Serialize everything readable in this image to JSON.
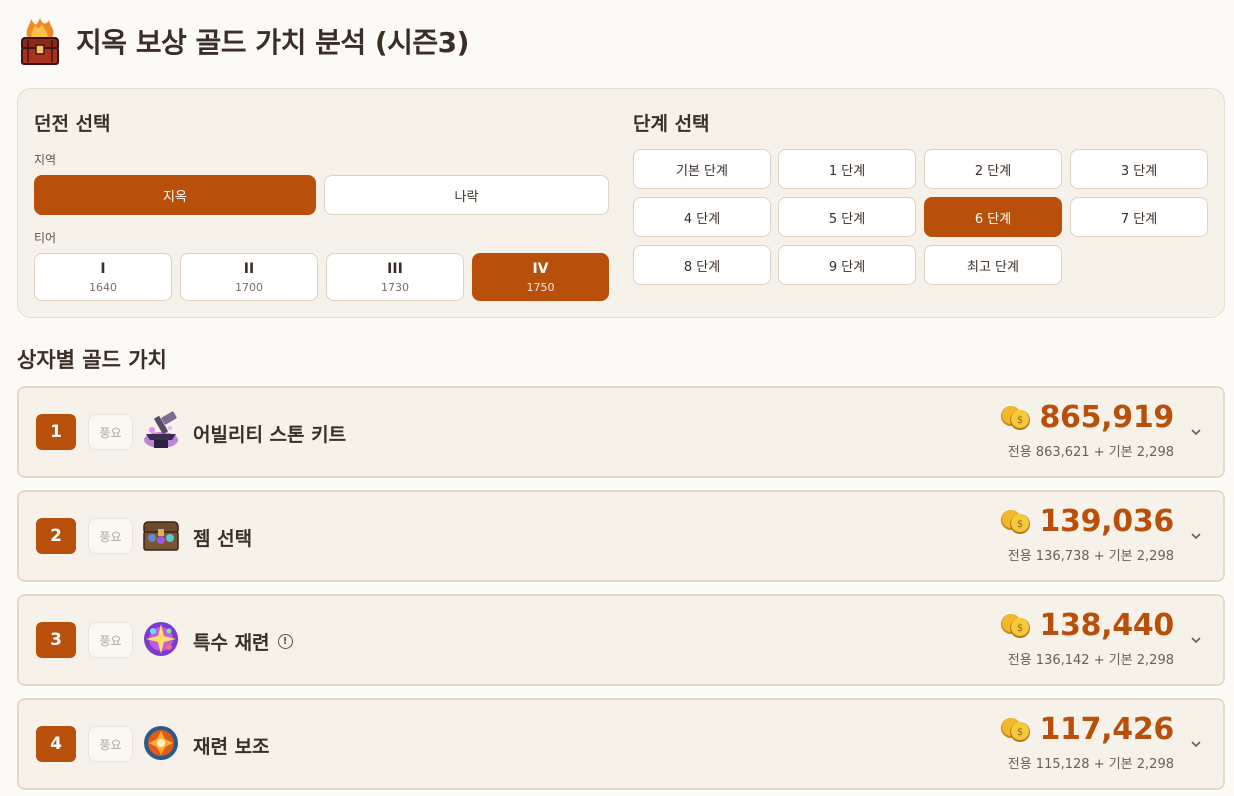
{
  "page": {
    "title": "지옥 보상 골드 가치 분석 (시즌3)",
    "title_icon": "flaming-treasure-chest-icon"
  },
  "dungeon": {
    "heading": "던전 선택",
    "region_label": "지역",
    "regions": [
      {
        "label": "지옥",
        "active": true
      },
      {
        "label": "나락",
        "active": false
      }
    ],
    "tier_label": "티어",
    "tiers": [
      {
        "roman": "I",
        "level": "1640",
        "active": false
      },
      {
        "roman": "II",
        "level": "1700",
        "active": false
      },
      {
        "roman": "III",
        "level": "1730",
        "active": false
      },
      {
        "roman": "IV",
        "level": "1750",
        "active": true
      }
    ]
  },
  "stage": {
    "heading": "단계 선택",
    "options": [
      {
        "label": "기본 단계",
        "active": false
      },
      {
        "label": "1 단계",
        "active": false
      },
      {
        "label": "2 단계",
        "active": false
      },
      {
        "label": "3 단계",
        "active": false
      },
      {
        "label": "4 단계",
        "active": false
      },
      {
        "label": "5 단계",
        "active": false
      },
      {
        "label": "6 단계",
        "active": true
      },
      {
        "label": "7 단계",
        "active": false
      },
      {
        "label": "8 단계",
        "active": false
      },
      {
        "label": "9 단계",
        "active": false
      },
      {
        "label": "최고 단계",
        "active": false
      }
    ]
  },
  "list": {
    "heading": "상자별 골드 가치",
    "items": [
      {
        "rank": "1",
        "tag": "풍요",
        "name": "어빌리티 스톤 키트",
        "icon": "ability-stone-anvil-icon",
        "value": "865,919",
        "breakdown": "전용 863,621 + 기본 2,298",
        "info": false
      },
      {
        "rank": "2",
        "tag": "풍요",
        "name": "젬 선택",
        "icon": "gem-chest-icon",
        "value": "139,036",
        "breakdown": "전용 136,738 + 기본 2,298",
        "info": false
      },
      {
        "rank": "3",
        "tag": "풍요",
        "name": "특수 재련",
        "icon": "special-refine-orb-icon",
        "value": "138,440",
        "breakdown": "전용 136,142 + 기본 2,298",
        "info": true
      },
      {
        "rank": "4",
        "tag": "풍요",
        "name": "재련 보조",
        "icon": "refine-support-icon",
        "value": "117,426",
        "breakdown": "전용 115,128 + 기본 2,298",
        "info": false
      }
    ]
  },
  "colors": {
    "accent": "#b8500b",
    "panel": "#f6f1e9",
    "background": "#fcfaf6",
    "text": "#3a2e26"
  }
}
